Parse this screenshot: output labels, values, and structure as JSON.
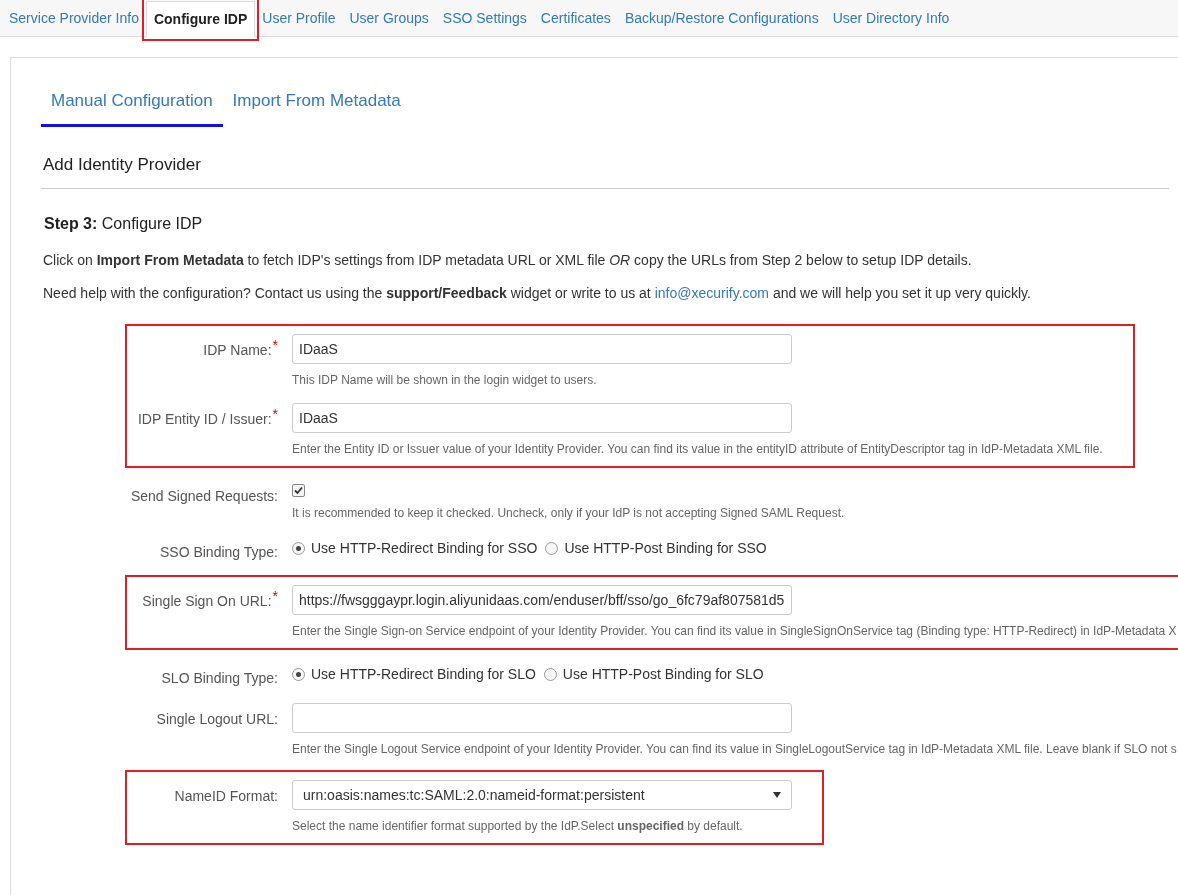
{
  "nav_tabs": [
    {
      "label": "Service Provider Info",
      "selected": false,
      "highlighted": false
    },
    {
      "label": "Configure IDP",
      "selected": true,
      "highlighted": true
    },
    {
      "label": "User Profile",
      "selected": false,
      "highlighted": false
    },
    {
      "label": "User Groups",
      "selected": false,
      "highlighted": false
    },
    {
      "label": "SSO Settings",
      "selected": false,
      "highlighted": false
    },
    {
      "label": "Certificates",
      "selected": false,
      "highlighted": false
    },
    {
      "label": "Backup/Restore Configurations",
      "selected": false,
      "highlighted": false
    },
    {
      "label": "User Directory Info",
      "selected": false,
      "highlighted": false
    }
  ],
  "sub_tabs": [
    {
      "label": "Manual Configuration",
      "selected": true
    },
    {
      "label": "Import From Metadata",
      "selected": false
    }
  ],
  "section_title": "Add Identity Provider",
  "step": {
    "number": "Step 3:",
    "title": "Configure IDP"
  },
  "intro": "Click on **Import From Metadata** to fetch IDP's settings from IDP metadata URL or XML file *OR* copy the URLs from Step 2 below to setup IDP details.",
  "help_line": {
    "before": "Need help with the configuration? Contact us using the **support/Feedback** widget or write to us at",
    "link": "info@xecurify.com",
    "after": "and we will help you set it up very quickly."
  },
  "form_groups": [
    {
      "highlighted": true,
      "rows": [
        {
          "kind": "text",
          "label": "IDP Name:",
          "required_mark": "*",
          "value": "IDaaS",
          "help": "This IDP Name will be shown in the login widget to users."
        },
        {
          "kind": "text",
          "label": "IDP Entity ID / Issuer:",
          "required_mark": "*",
          "value": "IDaaS",
          "help": "Enter the Entity ID or Issuer value of your Identity Provider. You can find its value in the entityID attribute of EntityDescriptor tag in IdP-Metadata XML file."
        }
      ]
    },
    {
      "highlighted": false,
      "rows": [
        {
          "kind": "checkbox",
          "label": "Send Signed Requests:",
          "checked": true,
          "help": "It is recommended to keep it checked. Uncheck, only if your IdP is not accepting Signed SAML Request."
        },
        {
          "kind": "radio",
          "label": "SSO Binding Type:",
          "options": [
            {
              "label": "Use HTTP-Redirect Binding for SSO",
              "selected": true
            },
            {
              "label": "Use HTTP-Post Binding for SSO",
              "selected": false
            }
          ]
        }
      ]
    },
    {
      "highlighted": true,
      "rows": [
        {
          "kind": "text",
          "label": "Single Sign On URL:",
          "required_mark": "*",
          "value": "https://fwsgggaypr.login.aliyunidaas.com/enduser/bff/sso/go_6fc79af807581d5",
          "help": "Enter the Single Sign-on Service endpoint of your Identity Provider. You can find its value in SingleSignOnService tag (Binding type: HTTP-Redirect) in IdP-Metadata X"
        }
      ]
    },
    {
      "highlighted": false,
      "rows": [
        {
          "kind": "radio",
          "label": "SLO Binding Type:",
          "options": [
            {
              "label": "Use HTTP-Redirect Binding for SLO",
              "selected": true
            },
            {
              "label": "Use HTTP-Post Binding for SLO",
              "selected": false
            }
          ]
        },
        {
          "kind": "text",
          "label": "Single Logout URL:",
          "help": "Enter the Single Logout Service endpoint of your Identity Provider. You can find its value in SingleLogoutService tag in IdP-Metadata XML file. Leave blank if SLO not s"
        }
      ]
    },
    {
      "highlighted": true,
      "rows": [
        {
          "kind": "select",
          "label": "NameID Format:",
          "value": "urn:oasis:names:tc:SAML:2.0:nameid-format:persistent",
          "help": "Select the name identifier format supported by the IdP.Select **unspecified** by default."
        }
      ]
    }
  ]
}
